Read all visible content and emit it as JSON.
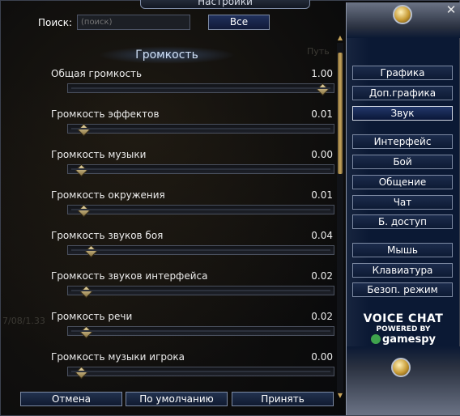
{
  "window": {
    "title": "Настройки"
  },
  "search": {
    "label": "Поиск:",
    "value": "",
    "placeholder": "(поиск)",
    "all_button": "Все"
  },
  "section": {
    "title": "Громкость"
  },
  "settings": [
    {
      "label": "Общая громкость",
      "value_text": "1.00",
      "value": 1.0
    },
    {
      "label": "Громкость эффектов",
      "value_text": "0.01",
      "value": 0.01
    },
    {
      "label": "Громкость музыки",
      "value_text": "0.00",
      "value": 0.0
    },
    {
      "label": "Громкость окружения",
      "value_text": "0.01",
      "value": 0.01
    },
    {
      "label": "Громкость звуков боя",
      "value_text": "0.04",
      "value": 0.04
    },
    {
      "label": "Громкость звуков интерфейса",
      "value_text": "0.02",
      "value": 0.02
    },
    {
      "label": "Громкость речи",
      "value_text": "0.02",
      "value": 0.02
    },
    {
      "label": "Громкость музыки игрока",
      "value_text": "0.00",
      "value": 0.0
    }
  ],
  "buttons": {
    "cancel": "Отмена",
    "defaults": "По умолчанию",
    "apply": "Принять"
  },
  "nav": [
    {
      "label": "Графика",
      "active": false
    },
    {
      "label": "Доп.графика",
      "active": false
    },
    {
      "label": "Звук",
      "active": true
    },
    {
      "label": "Интерфейс",
      "active": false
    },
    {
      "label": "Бой",
      "active": false
    },
    {
      "label": "Общение",
      "active": false
    },
    {
      "label": "Чат",
      "active": false
    },
    {
      "label": "Б. доступ",
      "active": false
    },
    {
      "label": "Мышь",
      "active": false
    },
    {
      "label": "Клавиатура",
      "active": false
    },
    {
      "label": "Безоп. режим",
      "active": false
    }
  ],
  "voice_chat": {
    "title": "VOICE CHAT",
    "powered": "POWERED BY",
    "brand_a": "game",
    "brand_b": "spy"
  },
  "background_ghost": [
    "Путь",
    "7/08/1.33"
  ],
  "icons": {
    "close": "close-icon",
    "orb": "gold-orb-icon"
  },
  "colors": {
    "panel": "#0b1934",
    "button_border": "#7d8aa3",
    "thumb_gold": "#c9a85e"
  }
}
